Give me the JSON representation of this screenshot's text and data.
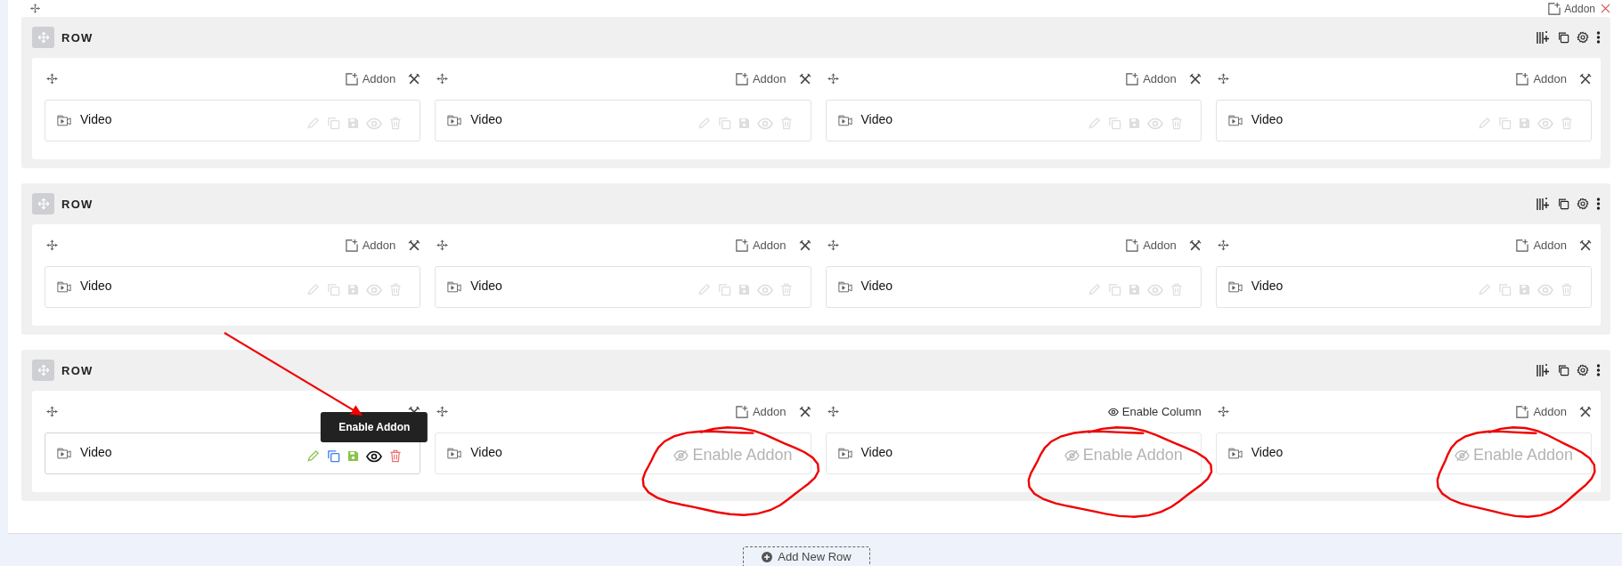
{
  "top_bar": {
    "addon_label": "Addon"
  },
  "rows": [
    {
      "label": "ROW",
      "columns": [
        {
          "header": {
            "kind": "addon",
            "label": "Addon"
          },
          "addon": {
            "title": "Video",
            "enabled": true,
            "hovered": false
          }
        },
        {
          "header": {
            "kind": "addon",
            "label": "Addon"
          },
          "addon": {
            "title": "Video",
            "enabled": true,
            "hovered": false
          }
        },
        {
          "header": {
            "kind": "addon",
            "label": "Addon"
          },
          "addon": {
            "title": "Video",
            "enabled": true,
            "hovered": false
          }
        },
        {
          "header": {
            "kind": "addon",
            "label": "Addon"
          },
          "addon": {
            "title": "Video",
            "enabled": true,
            "hovered": false
          }
        }
      ]
    },
    {
      "label": "ROW",
      "columns": [
        {
          "header": {
            "kind": "addon",
            "label": "Addon"
          },
          "addon": {
            "title": "Video",
            "enabled": true,
            "hovered": false
          }
        },
        {
          "header": {
            "kind": "addon",
            "label": "Addon"
          },
          "addon": {
            "title": "Video",
            "enabled": true,
            "hovered": false
          }
        },
        {
          "header": {
            "kind": "addon",
            "label": "Addon"
          },
          "addon": {
            "title": "Video",
            "enabled": true,
            "hovered": false
          }
        },
        {
          "header": {
            "kind": "addon",
            "label": "Addon"
          },
          "addon": {
            "title": "Video",
            "enabled": true,
            "hovered": false
          }
        }
      ]
    },
    {
      "label": "ROW",
      "columns": [
        {
          "header": {
            "kind": "addon"
          },
          "addon": {
            "title": "Video",
            "enabled": true,
            "hovered": true,
            "tooltip": "Enable Addon"
          }
        },
        {
          "header": {
            "kind": "addon",
            "label": "Addon"
          },
          "addon": {
            "title": "Video",
            "enabled": false,
            "hovered": false,
            "disabled_label": "Enable Addon"
          }
        },
        {
          "header": {
            "kind": "enable_column",
            "label": "Enable Column"
          },
          "addon": {
            "title": "Video",
            "enabled": false,
            "hovered": false,
            "disabled_label": "Enable Addon"
          }
        },
        {
          "header": {
            "kind": "addon",
            "label": "Addon"
          },
          "addon": {
            "title": "Video",
            "enabled": false,
            "hovered": false,
            "disabled_label": "Enable Addon"
          }
        }
      ]
    }
  ],
  "annotations": [
    {
      "kind": "arrow"
    },
    {
      "kind": "circle"
    },
    {
      "kind": "circle"
    },
    {
      "kind": "circle"
    }
  ],
  "add_row_button": "Add New Row"
}
